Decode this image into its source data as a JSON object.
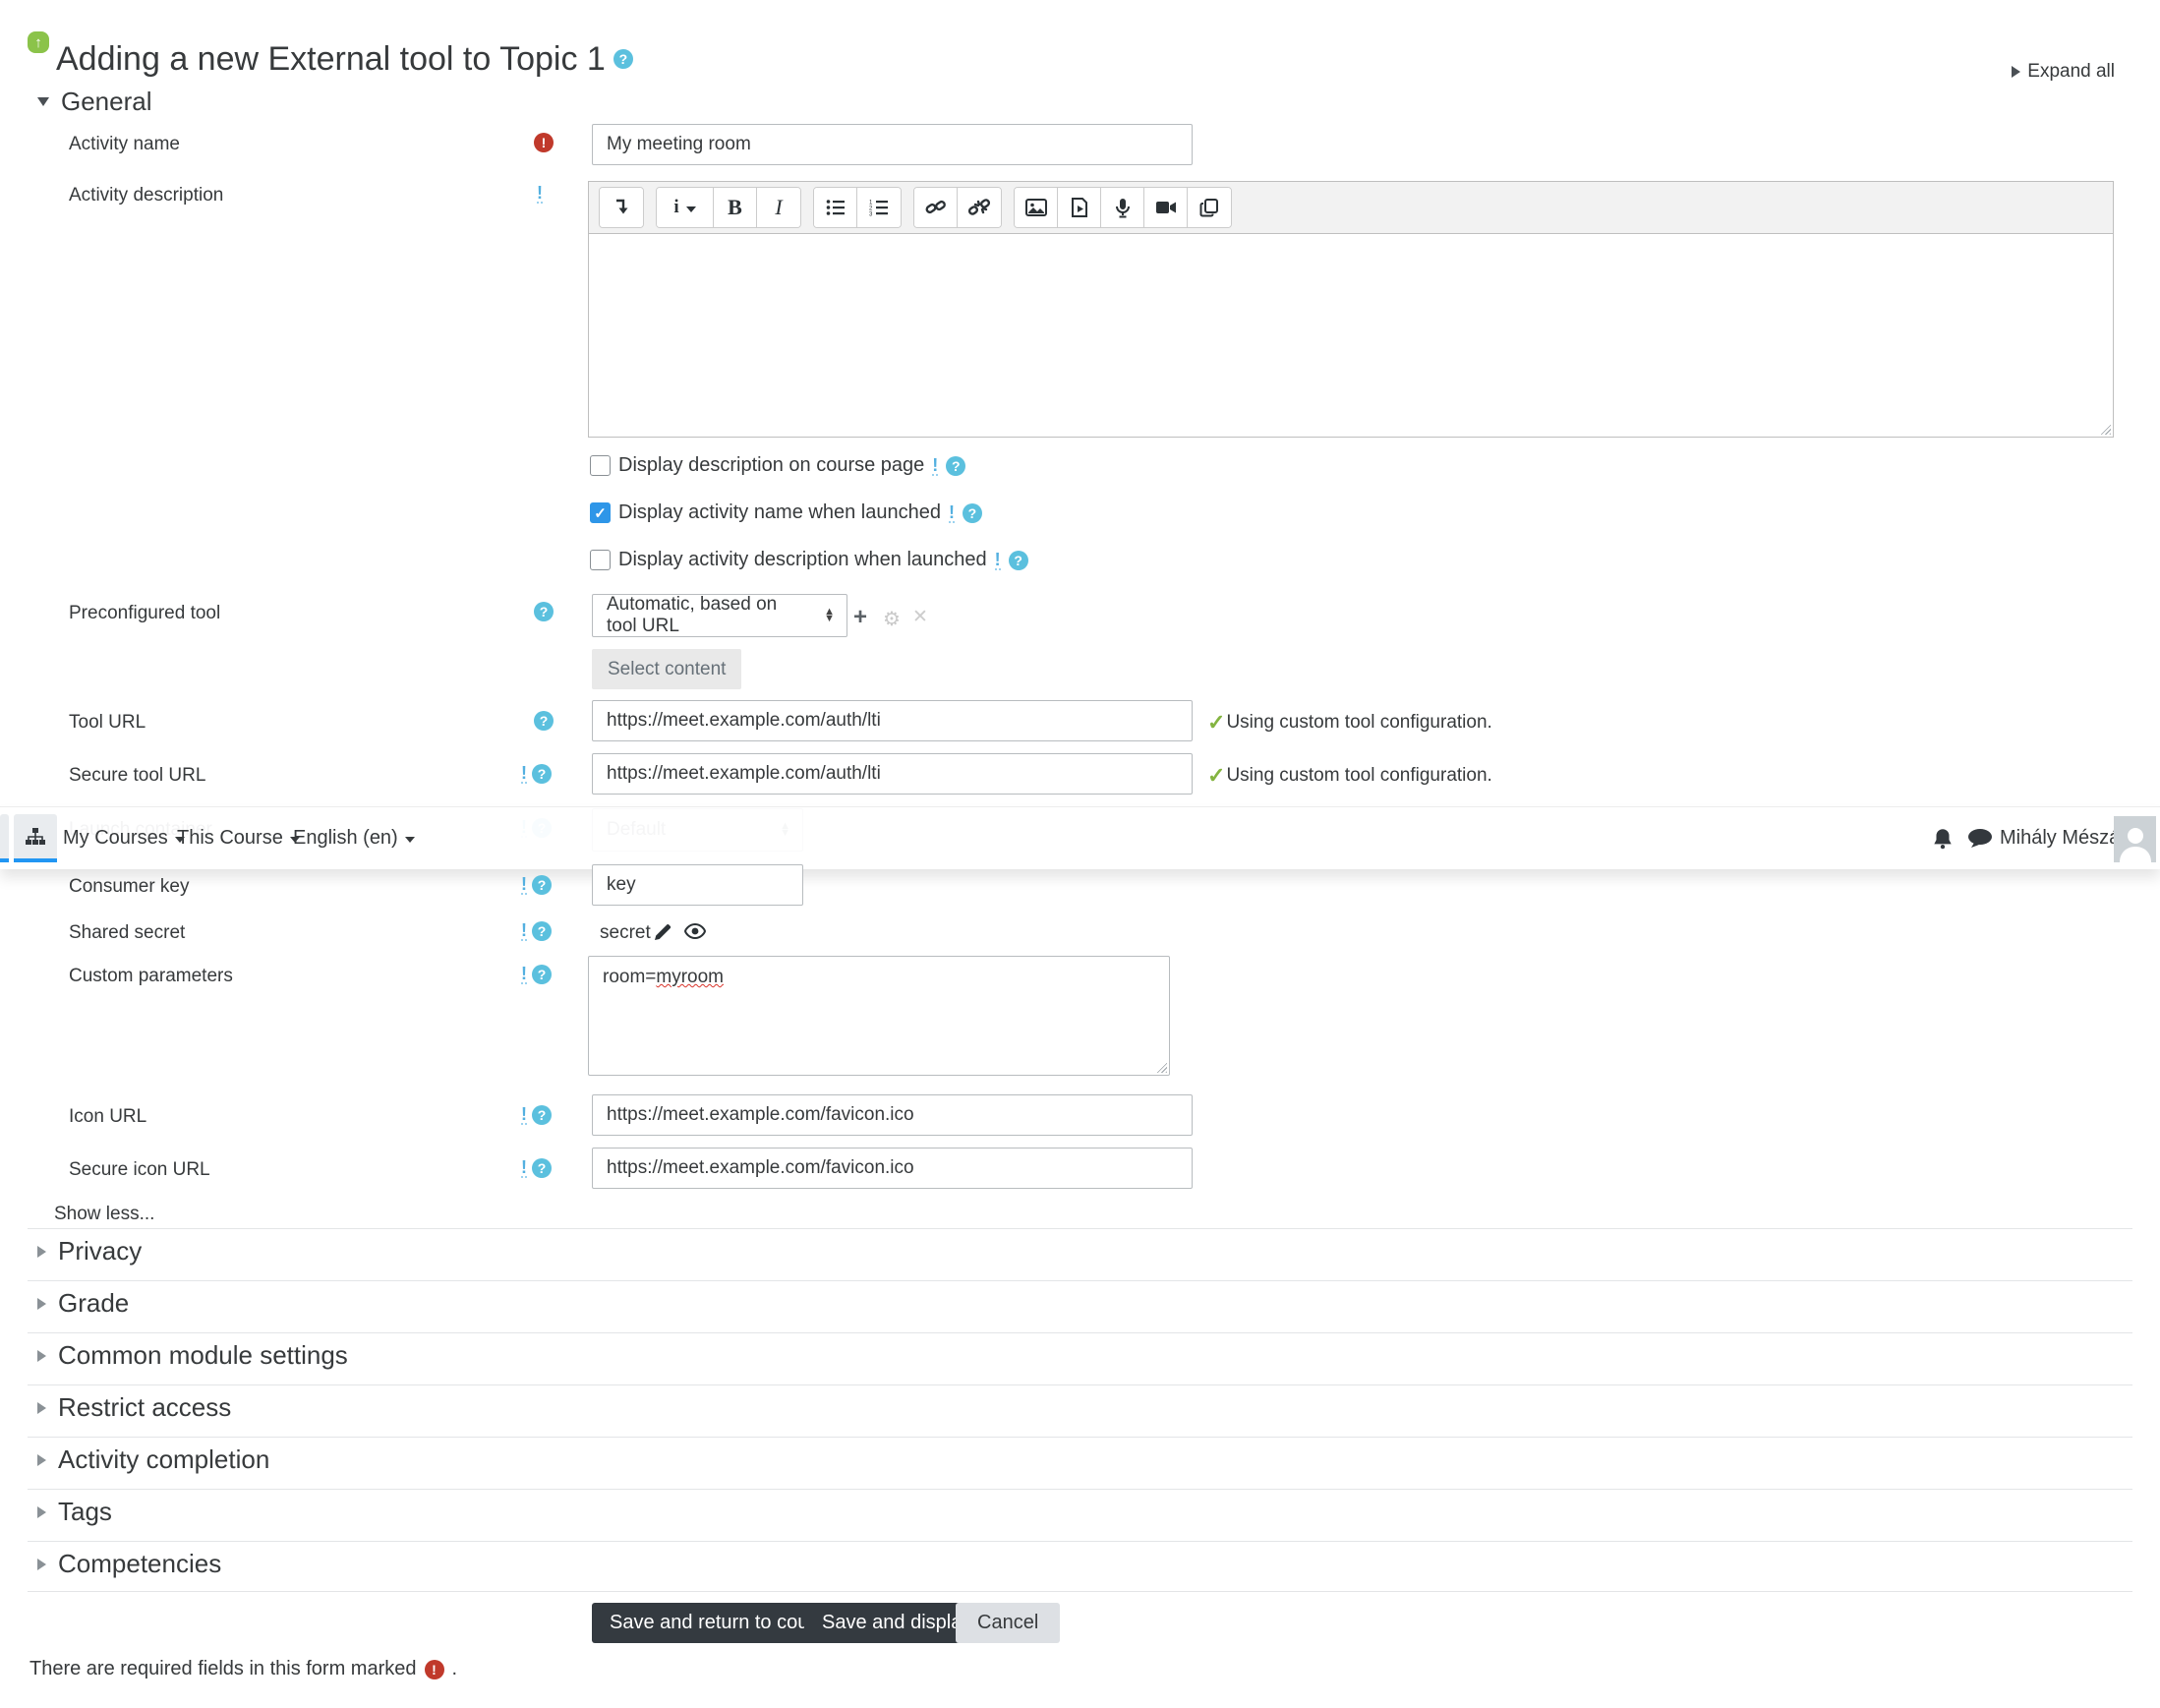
{
  "page": {
    "title": "Adding a new External tool to Topic 1",
    "expand_all": "Expand all",
    "show_less": "Show less...",
    "footer_text": "There are required fields in this form marked",
    "footer_period": "."
  },
  "navbar": {
    "menus": [
      "My Courses",
      "This Course",
      "English (en)"
    ],
    "user": "Mihály Mészáros"
  },
  "general": {
    "heading": "General",
    "activity_name": {
      "label": "Activity name",
      "value": "My meeting room"
    },
    "activity_description": {
      "label": "Activity description"
    },
    "editor_buttons": [
      "collapse-toolbar",
      "paragraph-styles",
      "bold",
      "italic",
      "unordered-list",
      "ordered-list",
      "link",
      "unlink",
      "insert-image",
      "insert-media",
      "record-audio",
      "record-video",
      "manage-files"
    ],
    "bold_glyph": "B",
    "italic_glyph": "I",
    "styles_glyph": "i",
    "checkboxes": [
      {
        "label": "Display description on course page",
        "checked": false
      },
      {
        "label": "Display activity name when launched",
        "checked": true
      },
      {
        "label": "Display activity description when launched",
        "checked": false
      }
    ],
    "preconfigured_tool": {
      "label": "Preconfigured tool",
      "value": "Automatic, based on tool URL",
      "select_content": "Select content"
    },
    "tool_url": {
      "label": "Tool URL",
      "value": "https://meet.example.com/auth/lti",
      "status": "Using custom tool configuration."
    },
    "secure_tool_url": {
      "label": "Secure tool URL",
      "value": "https://meet.example.com/auth/lti",
      "status": "Using custom tool configuration."
    },
    "launch_container": {
      "label": "Launch container",
      "value": "Default"
    },
    "consumer_key": {
      "label": "Consumer key",
      "value": "key"
    },
    "shared_secret": {
      "label": "Shared secret",
      "value": "secret"
    },
    "custom_parameters": {
      "label": "Custom parameters",
      "value": "room=myroom",
      "value_prefix": "room=",
      "value_flagged": "myroom"
    },
    "icon_url": {
      "label": "Icon URL",
      "value": "https://meet.example.com/favicon.ico"
    },
    "secure_icon_url": {
      "label": "Secure icon URL",
      "value": "https://meet.example.com/favicon.ico"
    }
  },
  "collapsed_sections": [
    "Privacy",
    "Grade",
    "Common module settings",
    "Restrict access",
    "Activity completion",
    "Tags",
    "Competencies"
  ],
  "actions": {
    "save_return": "Save and return to course",
    "save_display": "Save and display",
    "cancel": "Cancel"
  },
  "symbols": {
    "required": "!",
    "help": "?",
    "check": "✓",
    "up": "▲",
    "down": "▼"
  },
  "colors": {
    "accent_blue": "#2e96e8",
    "help_blue": "#5bc0de",
    "required_red": "#c0392b",
    "success_green": "#84b441",
    "tool_icon_green": "#8bc34a",
    "button_dark": "#343a40",
    "tab_underline_blue": "#2196f3"
  }
}
